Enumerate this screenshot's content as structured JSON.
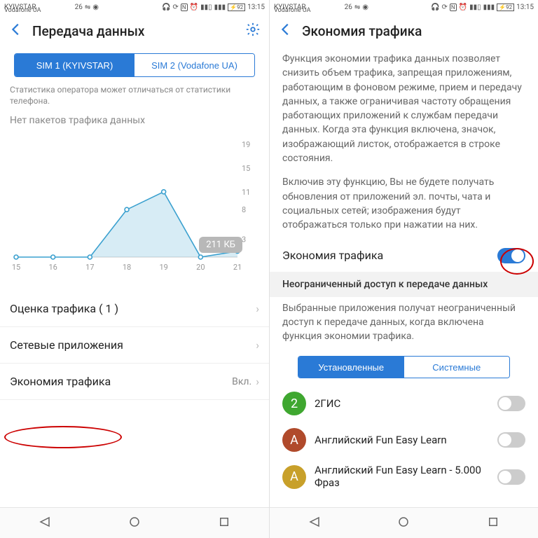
{
  "status": {
    "carrier1": "KYIVSTAR",
    "carrier2": "Vodafone UA",
    "signal_tag": "26",
    "battery": "92",
    "time": "13:15"
  },
  "left": {
    "title": "Передача данных",
    "tabs": [
      {
        "label": "SIM 1 (KYIVSTAR)",
        "active": true
      },
      {
        "label": "SIM 2 (Vodafone UA)",
        "active": false
      }
    ],
    "note": "Статистика оператора может отличаться от статистики телефона.",
    "empty_msg": "Нет пакетов трафика данных",
    "badge": "211 КБ",
    "rows": [
      {
        "label": "Оценка трафика ( 1 )",
        "value": ""
      },
      {
        "label": "Сетевые приложения",
        "value": ""
      },
      {
        "label": "Экономия трафика",
        "value": "Вкл."
      }
    ]
  },
  "right": {
    "title": "Экономия трафика",
    "para1": "Функция экономии трафика данных позволяет снизить объем трафика, запрещая приложениям, работающим в фоновом режиме, прием и передачу данных, а также ограничивая частоту обращения работающих приложений к службам передачи данных. Когда эта функция включена, значок, изображающий листок, отображается в строке состояния.",
    "para2": "Включив эту функцию, Вы не будете получать обновления от приложений эл. почты, чата и социальных сетей; изображения будут отображаться только при нажатии на них.",
    "toggle_label": "Экономия трафика",
    "toggle_on": true,
    "section_header": "Неограниченный доступ к передаче данных",
    "section_desc": "Выбранные приложения получат неограниченный доступ к передаче данных, когда включена функция экономии трафика.",
    "tabs2": [
      {
        "label": "Установленные",
        "active": true
      },
      {
        "label": "Системные",
        "active": false
      }
    ],
    "apps": [
      {
        "name": "2ГИС",
        "color": "#3fa730",
        "on": false
      },
      {
        "name": "Английский Fun Easy Learn",
        "color": "#b04a2b",
        "on": false
      },
      {
        "name": "Английский Fun Easy Learn - 5.000 Фраз",
        "color": "#c8a02a",
        "on": false
      }
    ]
  },
  "chart_data": {
    "type": "area",
    "x": [
      15,
      16,
      17,
      18,
      19,
      20,
      21
    ],
    "values": [
      0,
      0,
      0,
      8,
      11,
      0,
      1
    ],
    "ylim": [
      0,
      19
    ],
    "yticks": [
      3,
      8,
      11,
      15,
      19
    ],
    "xlabel": "",
    "ylabel": "",
    "title": ""
  }
}
